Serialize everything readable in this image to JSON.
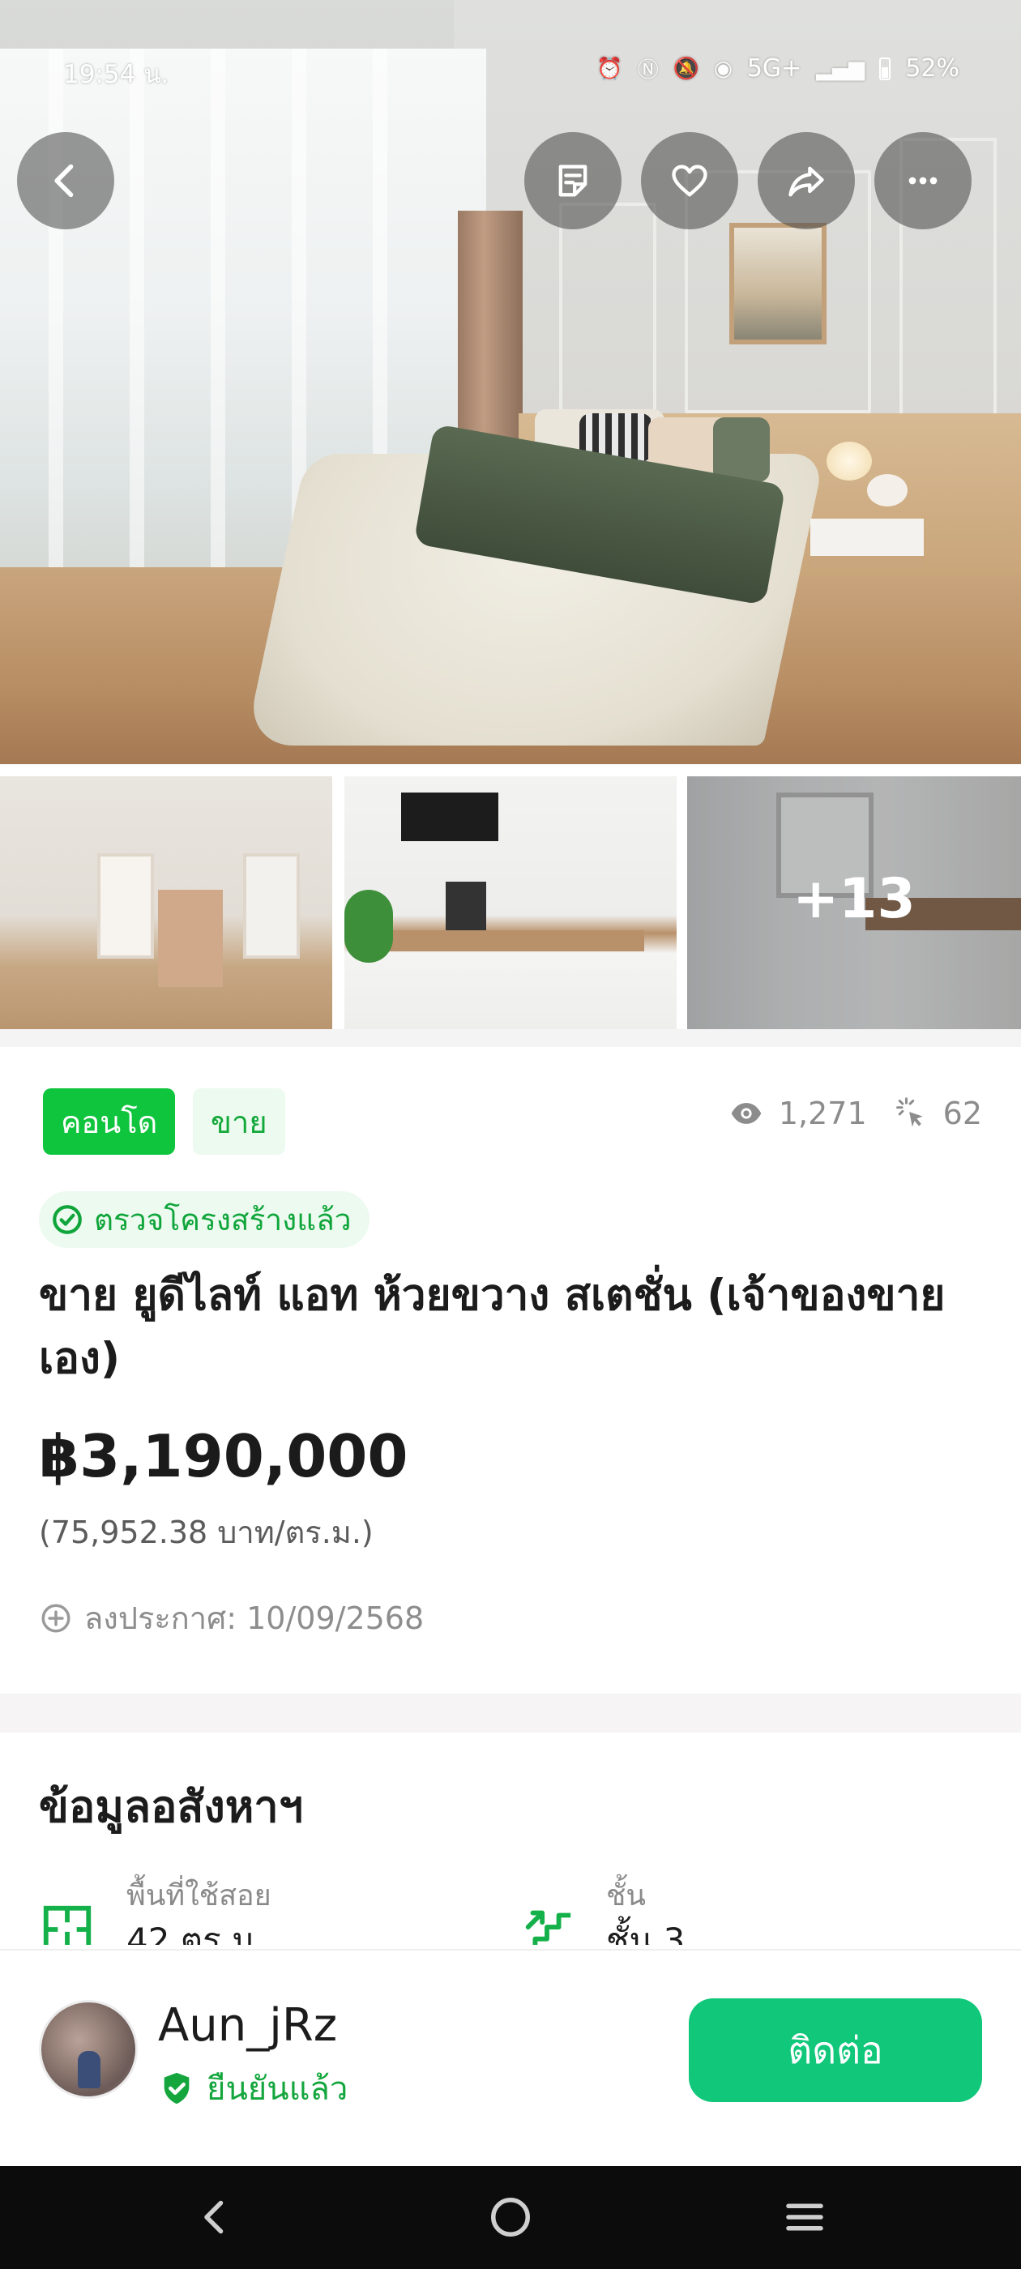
{
  "status_bar": {
    "time": "19:54 น.",
    "network": "5G+",
    "battery": "52%"
  },
  "gallery": {
    "more_count": "+13"
  },
  "listing": {
    "type_chip": "คอนโด",
    "deal_chip": "ขาย",
    "views": "1,271",
    "clicks": "62",
    "verified_label": "ตรวจโครงสร้างแล้ว",
    "title": "ขาย ยูดีไลท์ แอท ห้วยขวาง สเตชั่น (เจ้าของขายเอง)",
    "price": "฿3,190,000",
    "price_per_sqm": "(75,952.38 บาท/ตร.ม.)",
    "posted_label": "ลงประกาศ: 10/09/2568"
  },
  "property_info": {
    "section_title": "ข้อมูลอสังหาฯ",
    "area_label": "พื้นที่ใช้สอย",
    "area_value": "42 ตร.ม.",
    "floor_label": "ชั้น",
    "floor_value": "ชั้น 3"
  },
  "seller": {
    "name": "Aun_jRz",
    "verified": "ยืนยันแล้ว",
    "contact_label": "ติดต่อ"
  },
  "colors": {
    "brand_green": "#10c53e",
    "contact_green": "#10c77a",
    "verified_green": "#14a63d"
  },
  "icons": {
    "back": "arrow-left-icon",
    "note": "note-icon",
    "favorite": "heart-icon",
    "share": "share-icon",
    "more": "more-dots-icon",
    "views": "eye-icon",
    "clicks": "cursor-click-icon",
    "posted": "plus-circle-icon",
    "area": "floorplan-icon",
    "floor": "stairs-icon",
    "verified": "shield-check-icon"
  }
}
